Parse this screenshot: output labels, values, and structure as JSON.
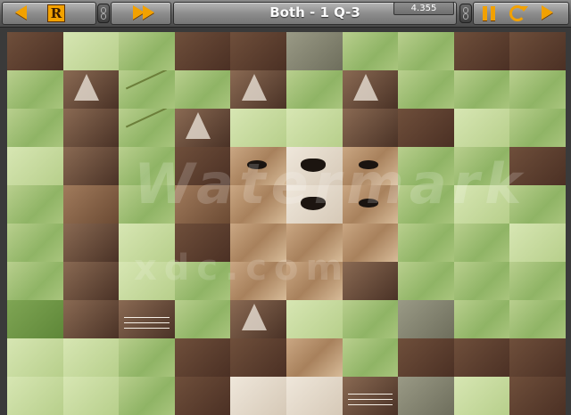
{
  "toolbar": {
    "title": "Both - 1 Q-3",
    "score": "4.355",
    "icons": {
      "back": "arrow-left-icon",
      "reveal": "r-icon",
      "skip": "fast-forward-icon",
      "pause": "pause-icon",
      "restart": "restart-icon",
      "next": "arrow-right-icon"
    },
    "accent_color": "#f2a100"
  },
  "board": {
    "rows": 10,
    "cols": 10,
    "tiles": [
      "b",
      "gl",
      "g",
      "b",
      "b",
      "gy",
      "g",
      "g",
      "b",
      "b",
      "g",
      "ear",
      "stem",
      "g",
      "ear",
      "g",
      "ear",
      "g",
      "g",
      "g",
      "g",
      "fd",
      "stem",
      "ear",
      "gl",
      "gl",
      "fd",
      "b",
      "gl",
      "g",
      "gl",
      "fd",
      "g",
      "b",
      "eye",
      "nose",
      "eye",
      "g",
      "g",
      "b",
      "g",
      "bl",
      "g",
      "bl",
      "f",
      "nose",
      "eye",
      "g",
      "gl",
      "g",
      "g",
      "fd",
      "gl",
      "b",
      "f",
      "f",
      "f",
      "g",
      "g",
      "gl",
      "g",
      "fd",
      "gl",
      "g",
      "f",
      "f",
      "fd",
      "g",
      "g",
      "g",
      "gd",
      "fd",
      "whisk",
      "g",
      "ear",
      "gl",
      "g",
      "gy",
      "g",
      "g",
      "gl",
      "gl",
      "g",
      "b",
      "b",
      "f",
      "g",
      "b",
      "b",
      "b",
      "gl",
      "gl",
      "g",
      "b",
      "w",
      "w",
      "whisk",
      "gy",
      "gl",
      "b"
    ]
  },
  "watermark": {
    "line1": "Watermark",
    "line2": "xdc.com"
  }
}
